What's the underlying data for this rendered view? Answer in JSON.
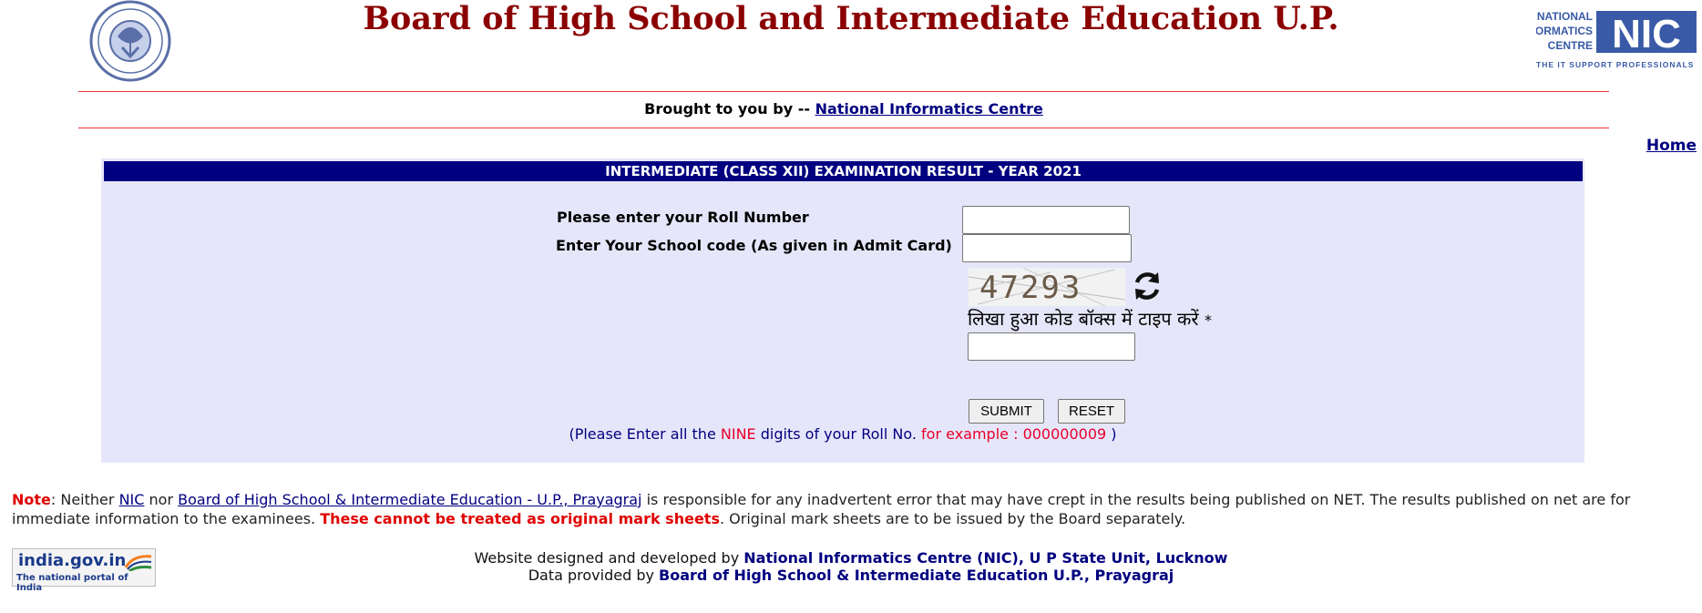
{
  "header": {
    "title": "Board of High School and Intermediate Education U.P.",
    "up_logo": "up-government-emblem",
    "nic_logo_lines": [
      "NATIONAL",
      "INFORMATICS",
      "CENTRE"
    ],
    "nic_logo_mark": "NIC",
    "nic_tagline": "THE IT SUPPORT PROFESSIONALS"
  },
  "brought_by": {
    "prefix": "Brought to you by --",
    "link": "National Informatics Centre"
  },
  "nav": {
    "home": "Home"
  },
  "form": {
    "title": "INTERMEDIATE (CLASS XII)  EXAMINATION RESULT - YEAR 2021",
    "roll_label": "Please enter your Roll Number",
    "roll_value": "",
    "school_label": "Enter Your School code (As given in Admit Card)",
    "school_value": "",
    "captcha_text": "47293",
    "captcha_prompt": "लिखा हुआ कोड बॉक्स में टाइप करें",
    "captcha_required": "*",
    "captcha_value": "",
    "submit_label": "SUBMIT",
    "reset_label": "RESET",
    "hint_part1": "(Please Enter all the",
    "hint_nine": "NINE",
    "hint_part2": "digits of your Roll No.",
    "hint_example": "for example : 000000009",
    "hint_close": ")"
  },
  "note": {
    "label": "Note",
    "t1": ": Neither",
    "nic_link": "NIC",
    "t2": "nor",
    "board_link": "Board of High School & Intermediate Education - U.P., Prayagraj",
    "t3": "is responsible for any inadvertent error that may have crept in the results being published on NET. The results published on net are for immediate information to the examinees.",
    "warning": "These cannot be treated as original mark sheets",
    "t4": ". Original mark sheets are to be issued by the Board separately."
  },
  "india_portal": {
    "name": "india.gov.in",
    "tagline": "The national portal of India"
  },
  "footer": {
    "designed_prefix": "Website designed and developed by",
    "designed_by": "National Informatics Centre (NIC), U P State Unit, Lucknow",
    "data_prefix": "Data provided by",
    "data_by": "Board of High School & Intermediate Education U.P., Prayagraj"
  },
  "colors": {
    "title": "#8b0000",
    "panel_bg": "#e6e6fa",
    "panel_header": "#000080",
    "accent_red": "#e00000",
    "link": "#000080"
  }
}
